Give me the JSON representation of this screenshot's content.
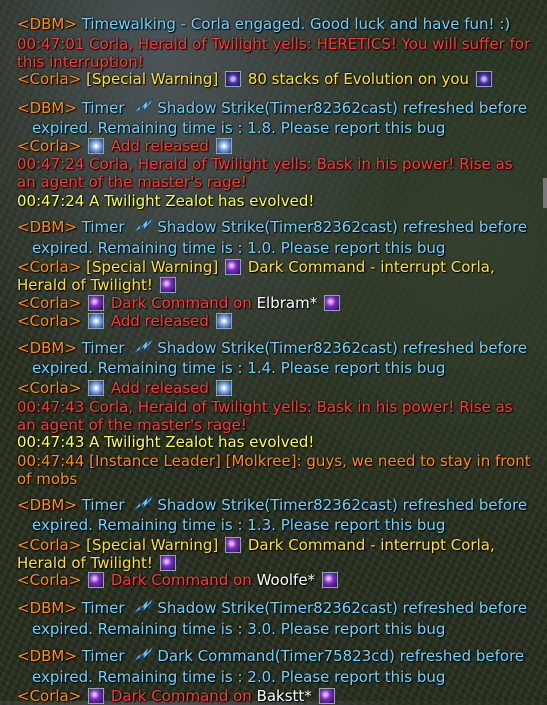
{
  "chat": {
    "lines": [
      {
        "parts": [
          {
            "t": "<DBM>",
            "c": "tag"
          },
          {
            "t": " Timewalking - Corla engaged. Good luck and have fun! :)",
            "c": "blue"
          }
        ]
      },
      {
        "parts": [
          {
            "t": "00:47:01 Corla, Herald of Twilight yells: HERETICS! You will suffer for this interruption!",
            "c": "red"
          }
        ]
      },
      {
        "parts": [
          {
            "t": "<Corla>",
            "c": "tag"
          },
          {
            "t": " [Special Warning] ",
            "c": "yellow"
          },
          {
            "icon": "evolution-icon"
          },
          {
            "t": " 80 stacks of Evolution on you ",
            "c": "yellow"
          },
          {
            "icon": "evolution-icon"
          }
        ]
      },
      {
        "parts": [
          {
            "t": "<DBM>",
            "c": "tag"
          },
          {
            "t": " Timer ",
            "c": "blue"
          },
          {
            "icon": "shadow-strike-icon"
          },
          {
            "t": "Shadow Strike(Timer82362cast) refreshed before",
            "c": "blue"
          }
        ]
      },
      {
        "parts": [
          {
            "t": "expired. Remaining time is : 1.8. Please report this bug",
            "c": "blue"
          }
        ],
        "cont": true
      },
      {
        "parts": [
          {
            "t": "<Corla>",
            "c": "tag"
          },
          {
            "t": " ",
            "c": "white"
          },
          {
            "icon": "star-icon"
          },
          {
            "t": " Add released ",
            "c": "red"
          },
          {
            "icon": "star-icon"
          }
        ]
      },
      {
        "parts": [
          {
            "t": "00:47:24 Corla, Herald of Twilight yells: Bask in his power! Rise as an agent of the master's rage!",
            "c": "red"
          }
        ]
      },
      {
        "parts": [
          {
            "t": "00:47:24 A Twilight Zealot has evolved!",
            "c": "sys"
          }
        ]
      },
      {
        "parts": [
          {
            "t": "<DBM>",
            "c": "tag"
          },
          {
            "t": " Timer ",
            "c": "blue"
          },
          {
            "icon": "shadow-strike-icon"
          },
          {
            "t": "Shadow Strike(Timer82362cast) refreshed before",
            "c": "blue"
          }
        ]
      },
      {
        "parts": [
          {
            "t": "expired. Remaining time is : 1.0. Please report this bug",
            "c": "blue"
          }
        ],
        "cont": true
      },
      {
        "parts": [
          {
            "t": "<Corla>",
            "c": "tag"
          },
          {
            "t": " [Special Warning] ",
            "c": "yellow"
          },
          {
            "icon": "dark-command-icon"
          },
          {
            "t": " Dark Command - interrupt Corla, Herald of Twilight! ",
            "c": "yellow"
          },
          {
            "icon": "dark-command-icon"
          }
        ]
      },
      {
        "parts": [
          {
            "t": "<Corla>",
            "c": "tag"
          },
          {
            "t": " ",
            "c": "white"
          },
          {
            "icon": "dark-command-icon"
          },
          {
            "t": " Dark Command on ",
            "c": "red"
          },
          {
            "t": "Elbram*",
            "c": "white"
          },
          {
            "t": " ",
            "c": "white"
          },
          {
            "icon": "dark-command-icon"
          }
        ]
      },
      {
        "parts": [
          {
            "t": "<Corla>",
            "c": "tag"
          },
          {
            "t": " ",
            "c": "white"
          },
          {
            "icon": "star-icon"
          },
          {
            "t": " Add released ",
            "c": "red"
          },
          {
            "icon": "star-icon"
          }
        ]
      },
      {
        "parts": [
          {
            "t": "<DBM>",
            "c": "tag"
          },
          {
            "t": " Timer ",
            "c": "blue"
          },
          {
            "icon": "shadow-strike-icon"
          },
          {
            "t": "Shadow Strike(Timer82362cast) refreshed before",
            "c": "blue"
          }
        ]
      },
      {
        "parts": [
          {
            "t": "expired. Remaining time is : 1.4. Please report this bug",
            "c": "blue"
          }
        ],
        "cont": true
      },
      {
        "parts": [
          {
            "t": "<Corla>",
            "c": "tag"
          },
          {
            "t": " ",
            "c": "white"
          },
          {
            "icon": "star-icon"
          },
          {
            "t": " Add released ",
            "c": "red"
          },
          {
            "icon": "star-icon"
          }
        ]
      },
      {
        "parts": [
          {
            "t": "00:47:43 Corla, Herald of Twilight yells: Bask in his power! Rise as an agent of the master's rage!",
            "c": "red"
          }
        ]
      },
      {
        "parts": [
          {
            "t": "00:47:43 A Twilight Zealot has evolved!",
            "c": "sys"
          }
        ]
      },
      {
        "parts": [
          {
            "t": "00:47:44 [Instance Leader] [Molkree]: guys, we need to stay in front of mobs",
            "c": "tag"
          }
        ]
      },
      {
        "parts": [
          {
            "t": "<DBM>",
            "c": "tag"
          },
          {
            "t": " Timer ",
            "c": "blue"
          },
          {
            "icon": "shadow-strike-icon"
          },
          {
            "t": "Shadow Strike(Timer82362cast) refreshed before",
            "c": "blue"
          }
        ]
      },
      {
        "parts": [
          {
            "t": "expired. Remaining time is : 1.3. Please report this bug",
            "c": "blue"
          }
        ],
        "cont": true
      },
      {
        "parts": [
          {
            "t": "<Corla>",
            "c": "tag"
          },
          {
            "t": " [Special Warning] ",
            "c": "yellow"
          },
          {
            "icon": "dark-command-icon"
          },
          {
            "t": " Dark Command - interrupt Corla, Herald of Twilight! ",
            "c": "yellow"
          },
          {
            "icon": "dark-command-icon"
          }
        ]
      },
      {
        "parts": [
          {
            "t": "<Corla>",
            "c": "tag"
          },
          {
            "t": " ",
            "c": "white"
          },
          {
            "icon": "dark-command-icon"
          },
          {
            "t": " Dark Command on ",
            "c": "red"
          },
          {
            "t": "Woolfe*",
            "c": "white"
          },
          {
            "t": " ",
            "c": "white"
          },
          {
            "icon": "dark-command-icon"
          }
        ]
      },
      {
        "parts": [
          {
            "t": "<DBM>",
            "c": "tag"
          },
          {
            "t": " Timer ",
            "c": "blue"
          },
          {
            "icon": "shadow-strike-icon"
          },
          {
            "t": "Shadow Strike(Timer82362cast) refreshed before",
            "c": "blue"
          }
        ]
      },
      {
        "parts": [
          {
            "t": "expired. Remaining time is : 3.0. Please report this bug",
            "c": "blue"
          }
        ],
        "cont": true
      },
      {
        "parts": [
          {
            "t": "<DBM>",
            "c": "tag"
          },
          {
            "t": " Timer ",
            "c": "blue"
          },
          {
            "icon": "shadow-strike-icon"
          },
          {
            "t": "Dark Command(Timer75823cd) refreshed before",
            "c": "blue"
          }
        ]
      },
      {
        "parts": [
          {
            "t": "expired. Remaining time is : 2.0. Please report this bug",
            "c": "blue"
          }
        ],
        "cont": true
      },
      {
        "parts": [
          {
            "t": "<Corla>",
            "c": "tag"
          },
          {
            "t": " ",
            "c": "white"
          },
          {
            "icon": "dark-command-icon"
          },
          {
            "t": " Dark Command on ",
            "c": "red"
          },
          {
            "t": "Bakstt*",
            "c": "white"
          },
          {
            "t": " ",
            "c": "white"
          },
          {
            "icon": "dark-command-icon"
          }
        ]
      }
    ]
  },
  "colors": {
    "tag": "#ff8c1a",
    "blue": "#6fd3ff",
    "red": "#ff3b30",
    "yellow": "#ffe033",
    "sys": "#ffff4d",
    "white": "#ffffff"
  }
}
